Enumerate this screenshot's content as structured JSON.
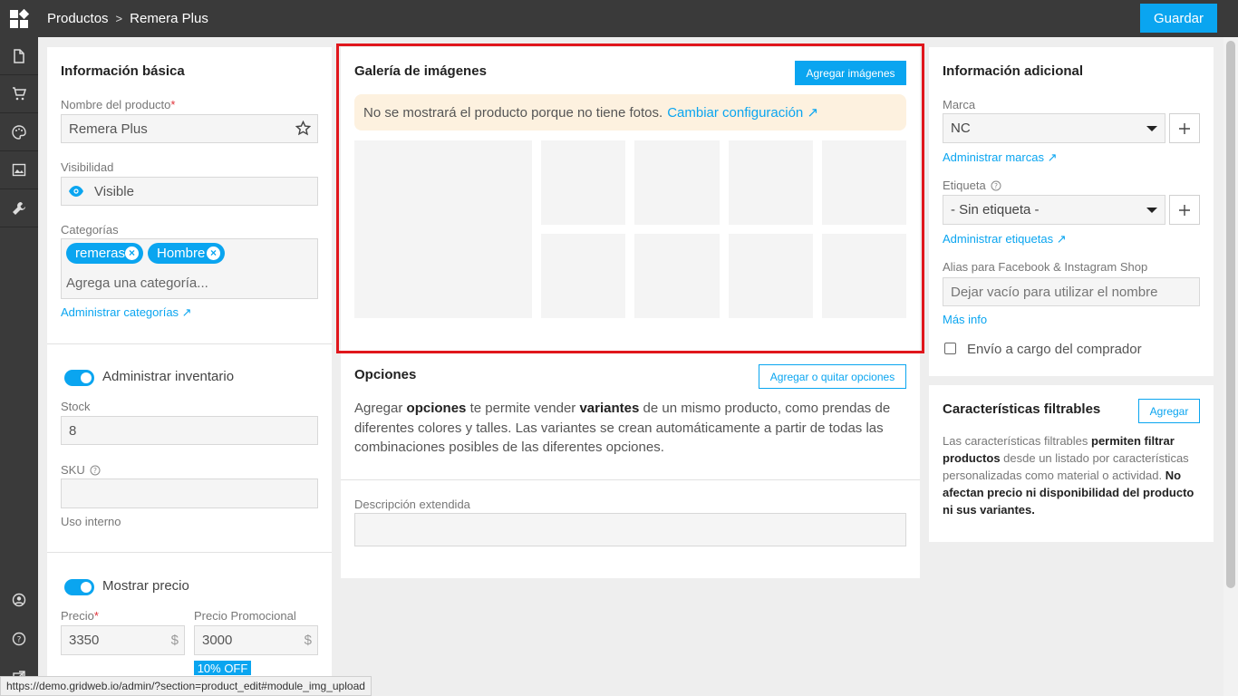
{
  "header": {
    "breadcrumb": [
      "Productos",
      "Remera Plus"
    ],
    "breadcrumb_sep": ">",
    "save_label": "Guardar"
  },
  "sidebar": {
    "icons": [
      "document-icon",
      "cart-icon",
      "palette-icon",
      "image-icon",
      "tools-icon"
    ],
    "bottom_icons": [
      "user-circle-icon",
      "help-icon",
      "external-icon"
    ]
  },
  "basic_info": {
    "title": "Información básica",
    "name_label": "Nombre del producto",
    "name_required": "*",
    "name_value": "Remera Plus",
    "visibility_label": "Visibilidad",
    "visibility_value": "Visible",
    "categories_label": "Categorías",
    "categories": [
      "remeras",
      "Hombre"
    ],
    "category_placeholder": "Agrega una categoría...",
    "manage_categories": "Administrar categorías ↗"
  },
  "inventory": {
    "toggle_label": "Administrar inventario",
    "stock_label": "Stock",
    "stock_value": "8",
    "sku_label": "SKU",
    "sku_value": "",
    "internal_use": "Uso interno"
  },
  "pricing": {
    "toggle_label": "Mostrar precio",
    "price_label": "Precio",
    "price_required": "*",
    "price_value": "3350",
    "promo_label": "Precio Promocional",
    "promo_value": "3000",
    "currency": "$",
    "discount_badge": "10% OFF"
  },
  "gallery": {
    "title": "Galería de imágenes",
    "add_images": "Agregar imágenes",
    "notice": "No se mostrará el producto porque no tiene fotos.",
    "notice_link": "Cambiar configuración ↗"
  },
  "options": {
    "title": "Opciones",
    "add_remove": "Agregar o quitar opciones",
    "desc_1": "Agregar ",
    "desc_bold_1": "opciones",
    "desc_2": " te permite vender ",
    "desc_bold_2": "variantes",
    "desc_3": " de un mismo producto, como prendas de diferentes colores y talles. Las variantes se crean automáticamente a partir de todas las combinaciones posibles de las diferentes opciones.",
    "extended_desc_label": "Descripción extendida"
  },
  "additional": {
    "title": "Información adicional",
    "brand_label": "Marca",
    "brand_value": "NC",
    "manage_brands": "Administrar marcas ↗",
    "tag_label": "Etiqueta",
    "tag_value": "- Sin etiqueta -",
    "manage_tags": "Administrar etiquetas ↗",
    "alias_label": "Alias para Facebook & Instagram Shop",
    "alias_placeholder": "Dejar vacío para utilizar el nombre",
    "more_info": "Más info",
    "shipping_label": "Envío a cargo del comprador"
  },
  "filters": {
    "title": "Características filtrables",
    "add": "Agregar",
    "p1": "Las características filtrables ",
    "b1": "permiten filtrar productos",
    "p2": " desde un listado por características personalizadas como material o actividad. ",
    "b2": "No afectan precio ni disponibilidad del producto ni sus variantes."
  },
  "status_url": "https://demo.gridweb.io/admin/?section=product_edit#module_img_upload",
  "colors": {
    "accent": "#0aa5f0",
    "topbar": "#3a3a3a",
    "highlight": "#e0161c"
  }
}
